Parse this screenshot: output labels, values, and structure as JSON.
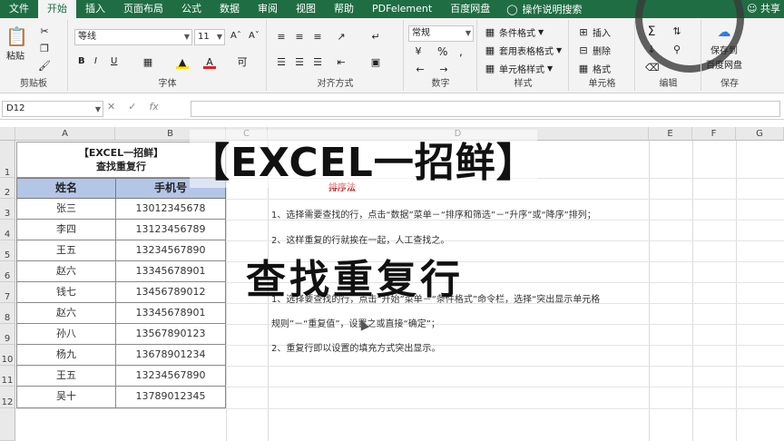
{
  "ribbon_tabs": [
    "文件",
    "开始",
    "插入",
    "页面布局",
    "公式",
    "数据",
    "审阅",
    "视图",
    "帮助",
    "PDFelement",
    "百度网盘"
  ],
  "tell_me": "操作说明搜索",
  "share": "共享",
  "clipboard": {
    "paste": "粘贴",
    "label": "剪贴板"
  },
  "font": {
    "name": "等线",
    "size": "11",
    "label": "字体",
    "bold": "B",
    "italic": "I",
    "underline": "U"
  },
  "alignment": {
    "label": "对齐方式"
  },
  "number": {
    "format": "常规",
    "label": "数字",
    "percent": "%",
    "comma": ","
  },
  "styles": {
    "conditional": "条件格式",
    "table": "套用表格格式",
    "cell": "单元格样式",
    "label": "样式"
  },
  "cells": {
    "insert": "插入",
    "delete": "删除",
    "format": "格式",
    "label": "单元格"
  },
  "editing": {
    "label": "编辑"
  },
  "save": {
    "line1": "保存到",
    "line2": "百度网盘",
    "label": "保存"
  },
  "namebox": "D12",
  "fx": "fx",
  "columns": [
    "A",
    "B",
    "C",
    "D",
    "E",
    "F",
    "G"
  ],
  "rows": [
    "1",
    "2",
    "3",
    "4",
    "5",
    "6",
    "7",
    "8",
    "9",
    "10",
    "11",
    "12"
  ],
  "table": {
    "title_line1": "【EXCEL一招鲜】",
    "title_line2": "查找重复行",
    "headers": [
      "姓名",
      "手机号"
    ],
    "rows": [
      [
        "张三",
        "13012345678"
      ],
      [
        "李四",
        "13123456789"
      ],
      [
        "王五",
        "13234567890"
      ],
      [
        "赵六",
        "13345678901"
      ],
      [
        "钱七",
        "13456789012"
      ],
      [
        "赵六",
        "13345678901"
      ],
      [
        "孙八",
        "13567890123"
      ],
      [
        "杨九",
        "13678901234"
      ],
      [
        "王五",
        "13234567890"
      ],
      [
        "吴十",
        "13789012345"
      ]
    ]
  },
  "notes": {
    "heading_red": "排序法",
    "line1": "1、选择需要查找的行，点击“数据”菜单－“排序和筛选”－“升序”或“降序”排列；",
    "line2": "2、这样重复的行就挨在一起，人工查找之。",
    "line3": "1、选择要查找的行，点击“开始”菜单－“条件格式”命令栏，选择“突出显示单元格",
    "line4": "规则”－“重复值”，设置之或直接“确定”；",
    "line5": "2、重复行即以设置的填充方式突出显示。"
  },
  "overlay": {
    "title": "【EXCEL一招鲜】",
    "subtitle": "查找重复行"
  }
}
